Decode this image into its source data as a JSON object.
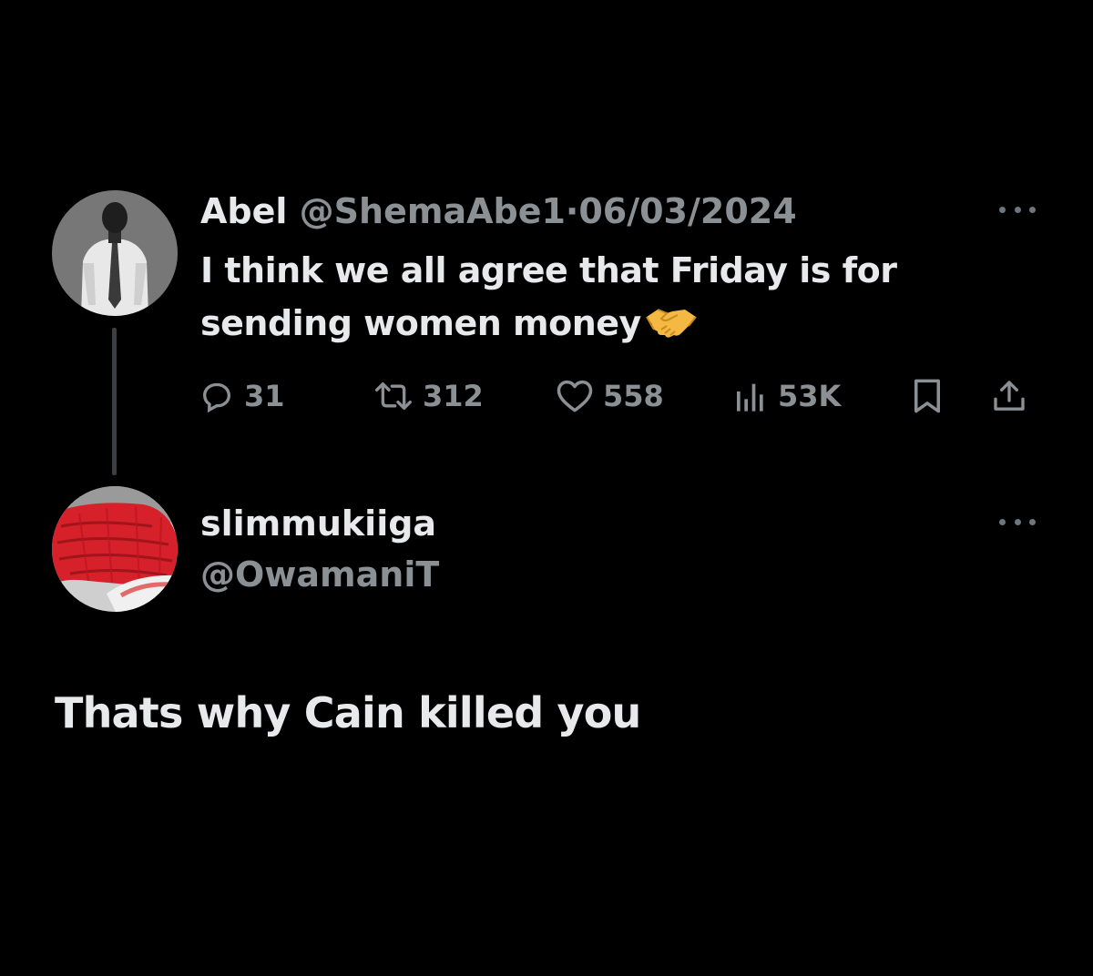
{
  "original_tweet": {
    "display_name": "Abel",
    "handle": "@ShemaAbe1",
    "separator": "·",
    "date": "06/03/2024",
    "text": "I think we all agree that Friday is for sending women money",
    "emoji": "handshake-emoji",
    "stats": {
      "replies": "31",
      "retweets": "312",
      "likes": "558",
      "views": "53K"
    }
  },
  "reply": {
    "display_name": "slimmukiiga",
    "handle": "@OwamaniT",
    "text": "Thats why Cain killed you"
  },
  "icons": {
    "more": "more-icon",
    "reply": "reply-icon",
    "retweet": "retweet-icon",
    "like": "heart-icon",
    "views": "views-icon",
    "bookmark": "bookmark-icon",
    "share": "share-icon"
  },
  "colors": {
    "background": "#000000",
    "primary_text": "#e7e9ea",
    "secondary_text": "#8b9095",
    "thread_line": "#3b3f43",
    "handshake": "#f4b942"
  }
}
